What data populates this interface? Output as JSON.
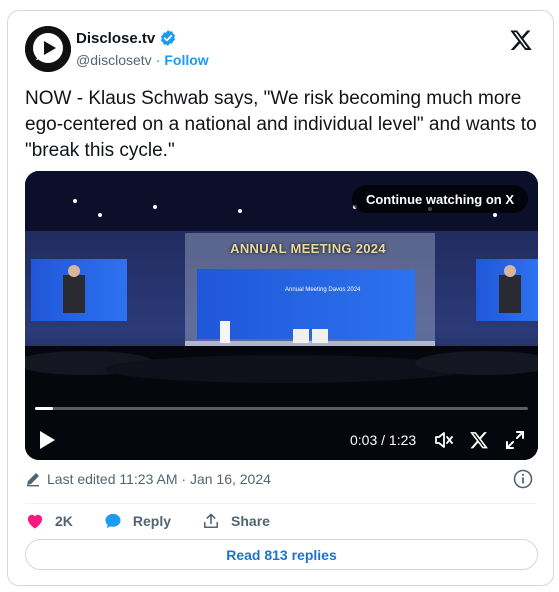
{
  "author": {
    "display_name": "Disclose.tv",
    "handle": "@disclosetv",
    "separator": "·",
    "follow_label": "Follow",
    "verified_color": "#1d9bf0"
  },
  "tweet": {
    "text": "NOW - Klaus Schwab says, \"We risk becoming much more ego-centered on a national and individual level\" and wants to \"break this cycle.\""
  },
  "video": {
    "continue_label": "Continue watching on X",
    "banner_text": "ANNUAL MEETING 2024",
    "screen_text": "Annual Meeting Davos 2024",
    "time": "0:03 / 1:23",
    "progress": 0.037
  },
  "meta": {
    "edited": "Last edited 11:23 AM · Jan 16, 2024"
  },
  "actions": {
    "like_count": "2K",
    "reply_label": "Reply",
    "share_label": "Share"
  },
  "replies_button": "Read 813 replies",
  "colors": {
    "accent": "#1d9bf0",
    "like": "#f91880",
    "text": "#0f1419",
    "muted": "#536471"
  }
}
